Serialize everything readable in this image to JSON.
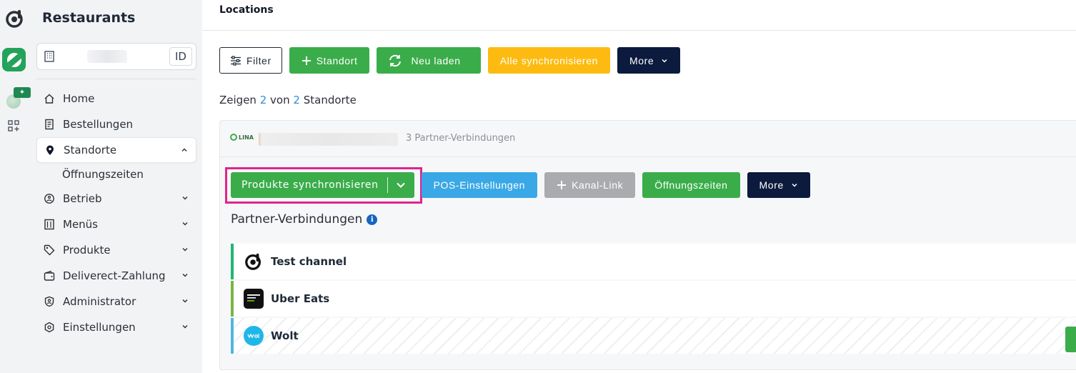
{
  "sidebar": {
    "title": "Restaurants",
    "account": {
      "id_label": "ID"
    },
    "items": [
      {
        "label": "Home",
        "icon": "home-icon"
      },
      {
        "label": "Bestellungen",
        "icon": "receipt-icon"
      },
      {
        "label": "Standorte",
        "icon": "location-pin-icon",
        "active": true,
        "expanded": true
      },
      {
        "label": "Betrieb",
        "icon": "operations-icon"
      },
      {
        "label": "Menüs",
        "icon": "menu-icon"
      },
      {
        "label": "Produkte",
        "icon": "tag-icon"
      },
      {
        "label": "Deliverect-Zahlung",
        "icon": "wallet-icon"
      },
      {
        "label": "Administrator",
        "icon": "admin-icon"
      },
      {
        "label": "Einstellungen",
        "icon": "settings-icon"
      }
    ],
    "subitems": [
      {
        "label": "Öffnungszeiten"
      }
    ]
  },
  "header": {
    "title": "Locations"
  },
  "toolbar": {
    "filter": "Filter",
    "add_location": "Standort",
    "reload": "Neu laden",
    "sync_all": "Alle synchronisieren",
    "more": "More"
  },
  "summary": {
    "prefix": "Zeigen",
    "shown": "2",
    "middle": "von",
    "total": "2",
    "suffix": "Standorte"
  },
  "location": {
    "logo_text": "LINA",
    "partner_count": "3 Partner-Verbindungen",
    "actions": {
      "sync_products": "Produkte synchronisieren",
      "pos_settings": "POS-Einstellungen",
      "channel_link": "Kanal-Link",
      "opening_hours": "Öffnungszeiten",
      "more": "More"
    },
    "partner_title": "Partner-Verbindungen",
    "channels": [
      {
        "name": "Test channel",
        "color": "#22b573"
      },
      {
        "name": "Uber Eats",
        "color": "#7cb342"
      },
      {
        "name": "Wolt",
        "color": "#4fb6e3"
      }
    ]
  },
  "colors": {
    "green": "#3aad4a",
    "yellow": "#fdbb11",
    "navy": "#0b1a3d",
    "blue": "#3aa8e6",
    "highlight": "#e0248c"
  }
}
